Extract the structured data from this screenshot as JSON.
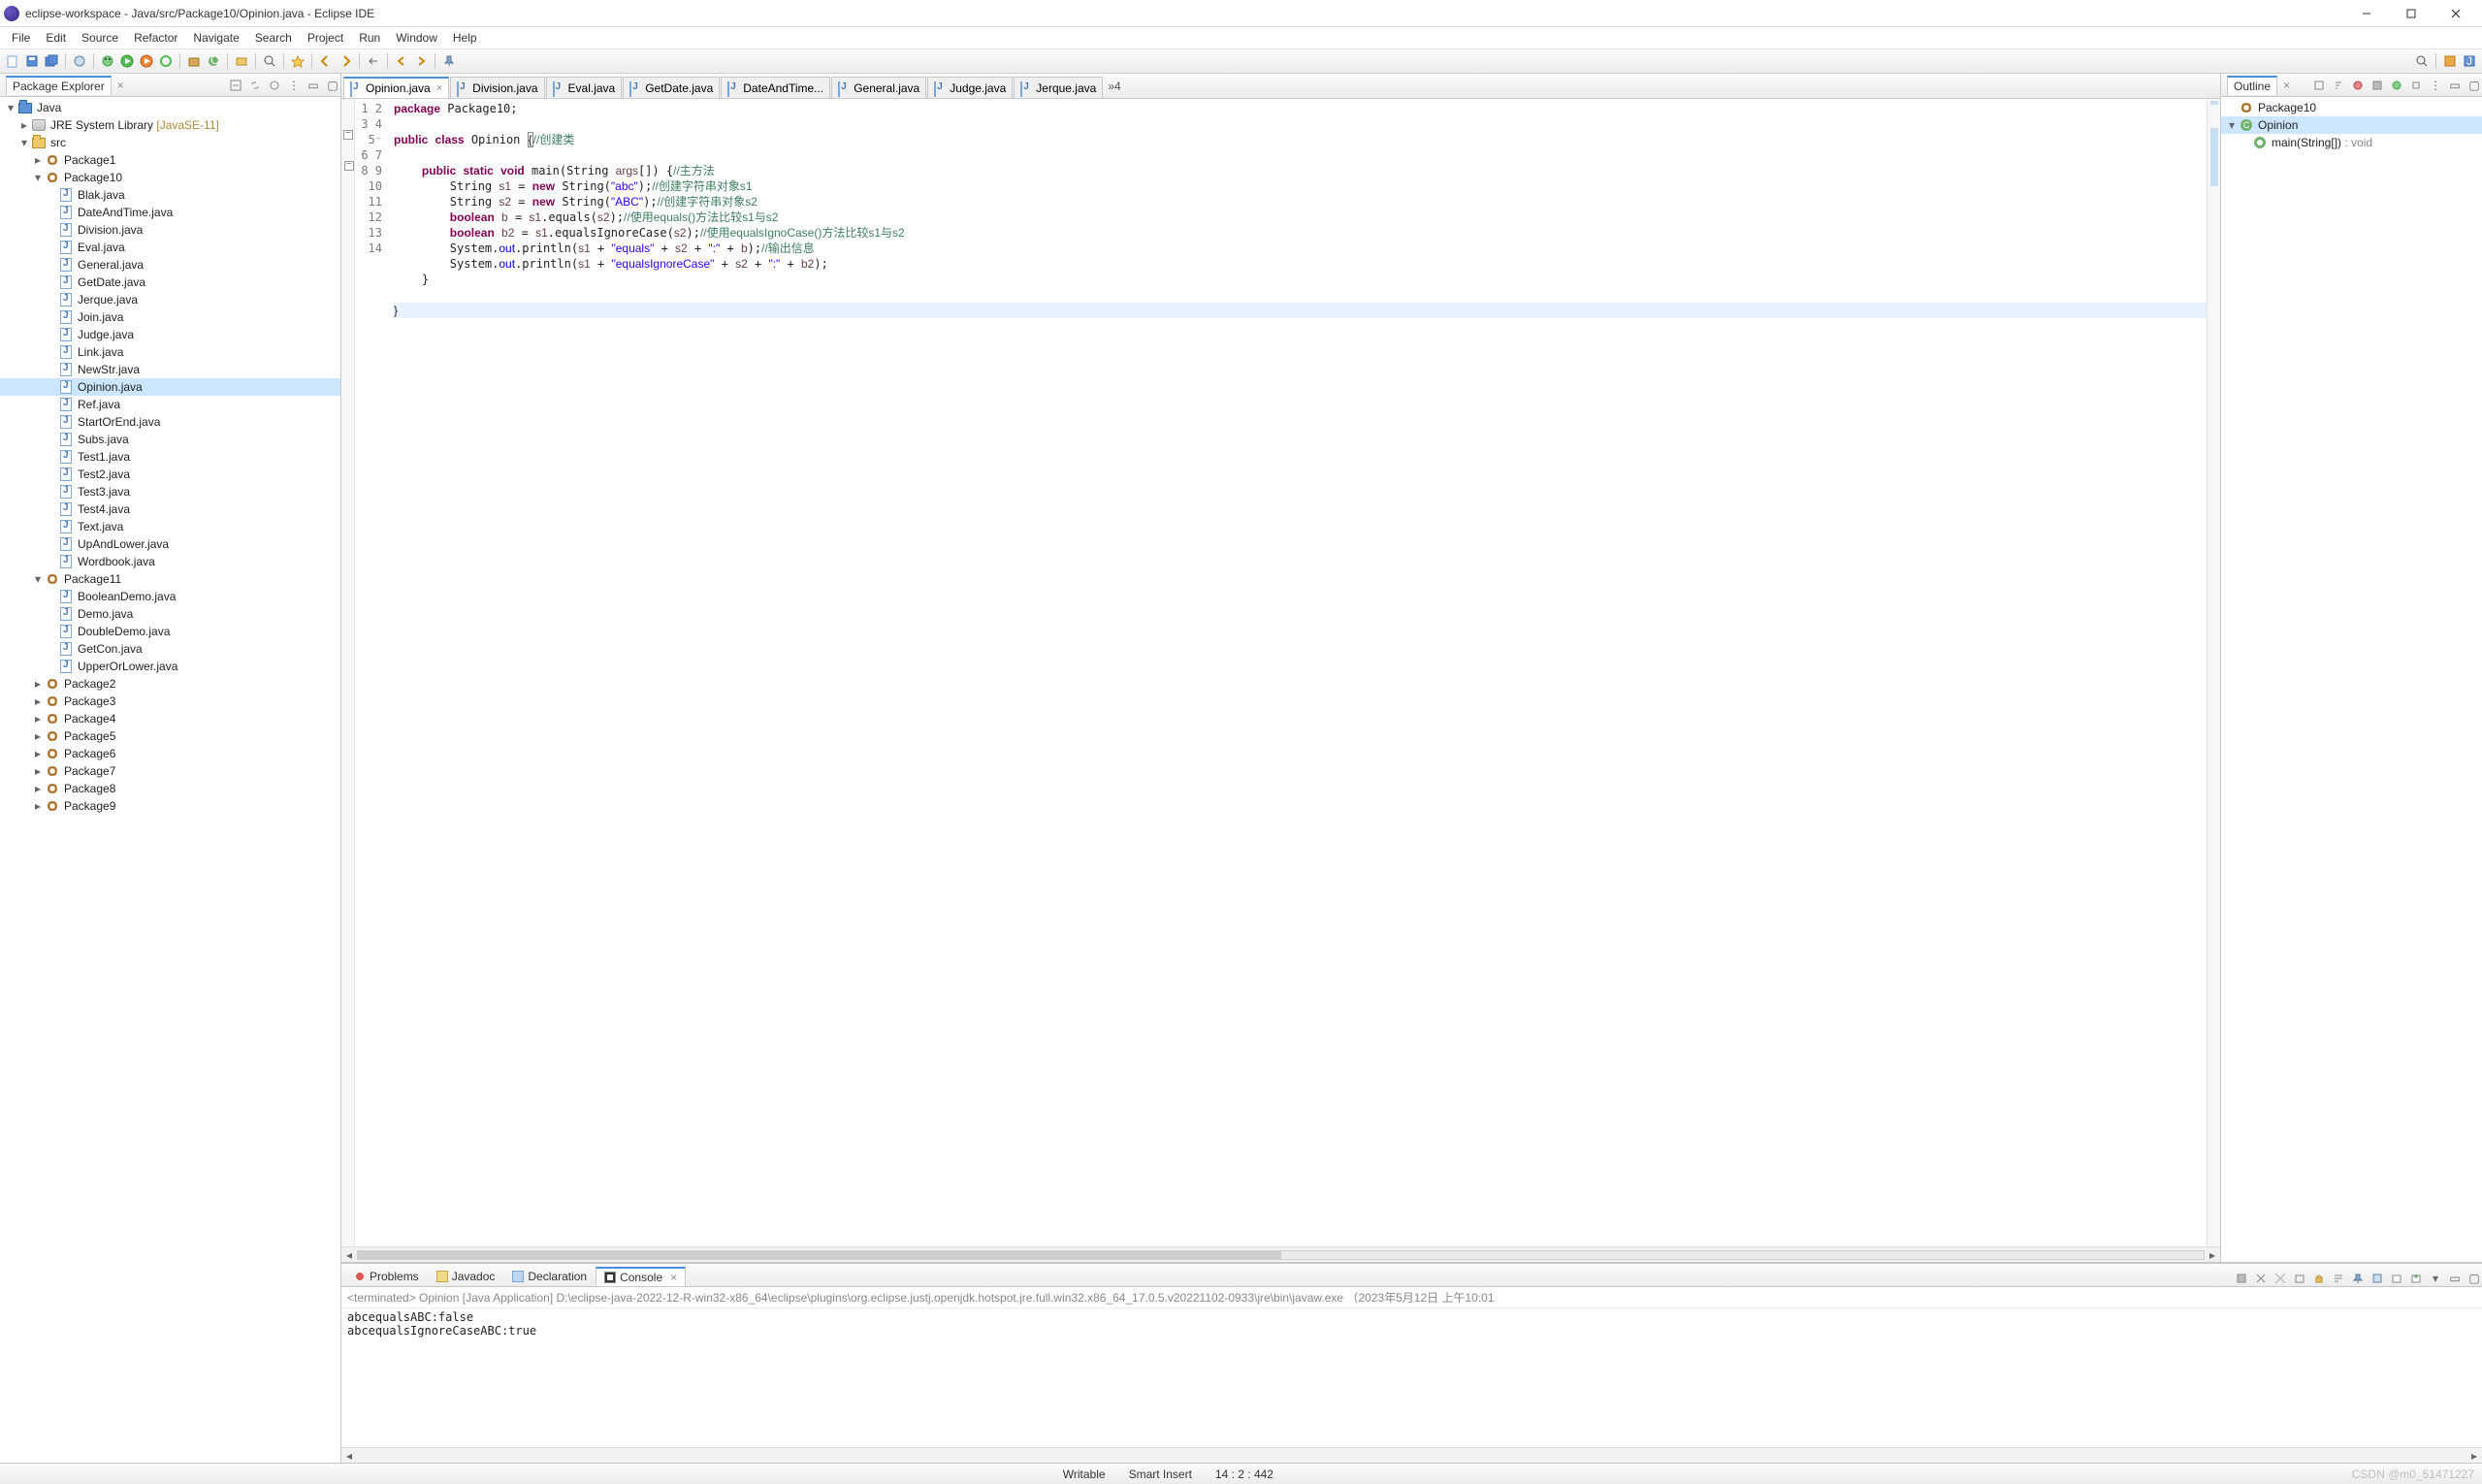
{
  "title": "eclipse-workspace - Java/src/Package10/Opinion.java - Eclipse IDE",
  "menus": [
    "File",
    "Edit",
    "Source",
    "Refactor",
    "Navigate",
    "Search",
    "Project",
    "Run",
    "Window",
    "Help"
  ],
  "leftPanel": {
    "title": "Package Explorer",
    "tree": {
      "project": "Java",
      "jre": "JRE System Library",
      "jreVer": "[JavaSE-11]",
      "srcFolder": "src",
      "packages": [
        {
          "name": "Package1",
          "expanded": false
        },
        {
          "name": "Package10",
          "expanded": true,
          "files": [
            "Blak.java",
            "DateAndTime.java",
            "Division.java",
            "Eval.java",
            "General.java",
            "GetDate.java",
            "Jerque.java",
            "Join.java",
            "Judge.java",
            "Link.java",
            "NewStr.java",
            "Opinion.java",
            "Ref.java",
            "StartOrEnd.java",
            "Subs.java",
            "Test1.java",
            "Test2.java",
            "Test3.java",
            "Test4.java",
            "Text.java",
            "UpAndLower.java",
            "Wordbook.java"
          ]
        },
        {
          "name": "Package11",
          "expanded": true,
          "files": [
            "BooleanDemo.java",
            "Demo.java",
            "DoubleDemo.java",
            "GetCon.java",
            "UpperOrLower.java"
          ]
        },
        {
          "name": "Package2",
          "expanded": false
        },
        {
          "name": "Package3",
          "expanded": false
        },
        {
          "name": "Package4",
          "expanded": false
        },
        {
          "name": "Package5",
          "expanded": false
        },
        {
          "name": "Package6",
          "expanded": false
        },
        {
          "name": "Package7",
          "expanded": false
        },
        {
          "name": "Package8",
          "expanded": false
        },
        {
          "name": "Package9",
          "expanded": false
        }
      ],
      "selectedFile": "Opinion.java"
    }
  },
  "editor": {
    "tabs": [
      "Opinion.java",
      "Division.java",
      "Eval.java",
      "GetDate.java",
      "DateAndTime...",
      "General.java",
      "Judge.java",
      "Jerque.java"
    ],
    "activeTab": "Opinion.java",
    "moreCount": "»4",
    "lineCount": 14,
    "code": {
      "l1": {
        "pre": "",
        "kw": "package",
        "post": " Package10;"
      },
      "l2": "",
      "l3": {
        "kw1": "public",
        "kw2": "class",
        "name": " Opinion ",
        "brace": "{",
        "cm": "//创建类"
      },
      "l4": "",
      "l5": {
        "indent": "    ",
        "kw1": "public",
        "kw2": "static",
        "kw3": "void",
        "name": " main(String ",
        "arg": "args",
        "post": "[]) {",
        "cm": "//主方法"
      },
      "l6": {
        "indent": "        ",
        "txt1": "String ",
        "var": "s1",
        "txt2": " = ",
        "kw": "new",
        "txt3": " String(",
        "str": "\"abc\"",
        "txt4": ");",
        "cm": "//创建字符串对象s1"
      },
      "l7": {
        "indent": "        ",
        "txt1": "String ",
        "var": "s2",
        "txt2": " = ",
        "kw": "new",
        "txt3": " String(",
        "str": "\"ABC\"",
        "txt4": ");",
        "cm": "//创建字符串对象s2"
      },
      "l8": {
        "indent": "        ",
        "kw": "boolean",
        "txt1": " ",
        "var": "b",
        "txt2": " = ",
        "v1": "s1",
        "txt3": ".equals(",
        "v2": "s2",
        "txt4": ");",
        "cm": "//使用equals()方法比较s1与s2"
      },
      "l9": {
        "indent": "        ",
        "kw": "boolean",
        "txt1": " ",
        "var": "b2",
        "txt2": " = ",
        "v1": "s1",
        "txt3": ".equalsIgnoreCase(",
        "v2": "s2",
        "txt4": ");",
        "cm": "//使用equalsIgnoCase()方法比较s1与s2"
      },
      "l10": {
        "indent": "        ",
        "txt1": "System.",
        "fld": "out",
        "txt2": ".println(",
        "v1": "s1",
        "txt3": " + ",
        "str1": "\"equals\"",
        "txt4": " + ",
        "v2": "s2",
        "txt5": " + ",
        "str2": "\":\"",
        "txt6": " + ",
        "v3": "b",
        "txt7": ");",
        "cm": "//输出信息"
      },
      "l11": {
        "indent": "        ",
        "txt1": "System.",
        "fld": "out",
        "txt2": ".println(",
        "v1": "s1",
        "txt3": " + ",
        "str1": "\"equalsIgnoreCase\"",
        "txt4": " + ",
        "v2": "s2",
        "txt5": " + ",
        "str2": "\":\"",
        "txt6": " + ",
        "v3": "b2",
        "txt7": ");"
      },
      "l12": "    }",
      "l13": "",
      "l14": "}"
    }
  },
  "outline": {
    "title": "Outline",
    "pkg": "Package10",
    "cls": "Opinion",
    "method": "main(String[])",
    "ret": " : void"
  },
  "bottom": {
    "tabs": [
      "Problems",
      "Javadoc",
      "Declaration",
      "Console"
    ],
    "activeTab": "Console",
    "header": "<terminated> Opinion [Java Application] D:\\eclipse-java-2022-12-R-win32-x86_64\\eclipse\\plugins\\org.eclipse.justj.openjdk.hotspot.jre.full.win32.x86_64_17.0.5.v20221102-0933\\jre\\bin\\javaw.exe （2023年5月12日 上午10:01",
    "lines": [
      "abcequalsABC:false",
      "abcequalsIgnoreCaseABC:true"
    ]
  },
  "status": {
    "writable": "Writable",
    "insert": "Smart Insert",
    "pos": "14 : 2 : 442",
    "watermark": "CSDN @m0_51471227"
  }
}
